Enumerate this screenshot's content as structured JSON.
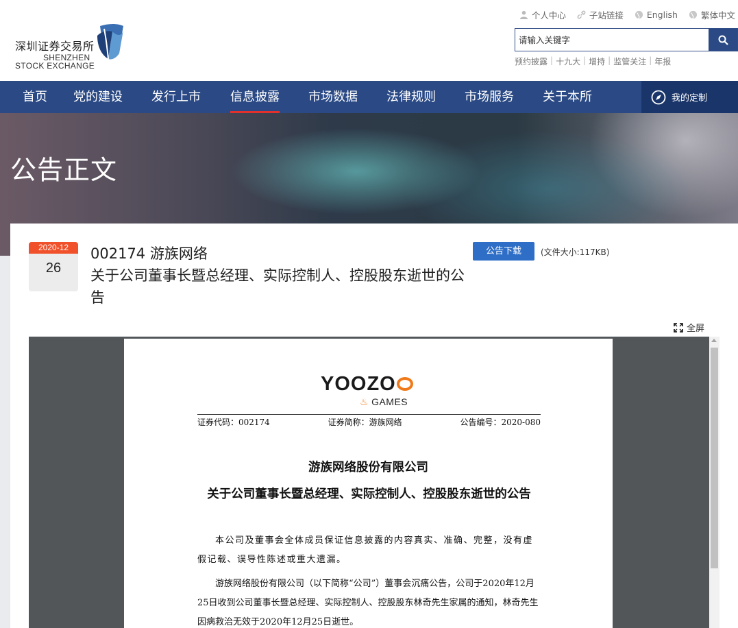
{
  "header": {
    "logo": {
      "cn": "深圳证券交易所",
      "en1": "SHENZHEN",
      "en2": "STOCK EXCHANGE"
    },
    "toplinks": [
      {
        "label": "个人中心",
        "icon": "user-icon"
      },
      {
        "label": "子站链接",
        "icon": "link-icon"
      },
      {
        "label": "English",
        "icon": "globe-icon"
      },
      {
        "label": "繁体中文",
        "icon": "globe-icon"
      }
    ],
    "search": {
      "placeholder": "请输入关键字"
    },
    "hotwords": [
      "预约披露",
      "十九大",
      "增持",
      "监管关注",
      "年报"
    ]
  },
  "nav": {
    "items": [
      "首页",
      "党的建设",
      "发行上市",
      "信息披露",
      "市场数据",
      "法律规则",
      "市场服务",
      "关于本所"
    ],
    "active": "信息披露",
    "custom": "我的定制"
  },
  "banner": {
    "title": "公告正文"
  },
  "announcement": {
    "month": "2020-12",
    "day": "26",
    "code_name": "002174 游族网络",
    "title": "关于公司董事长暨总经理、实际控制人、控股股东逝世的公告",
    "download_label": "公告下载",
    "file_size": "(文件大小:117KB)",
    "fullscreen_label": "全屏"
  },
  "document": {
    "logo_text": "YOOZO",
    "logo_sub": "GAMES",
    "security_code": "证券代码：002174",
    "security_abbr": "证券简称：游族网络",
    "notice_no": "公告编号：2020-080",
    "company": "游族网络股份有限公司",
    "heading": "关于公司董事长暨总经理、实际控制人、控股股东逝世的公告",
    "para1": "本公司及董事会全体成员保证信息披露的内容真实、准确、完整，没有虚假记载、误导性陈述或重大遗漏。",
    "para2": "游族网络股份有限公司（以下简称“公司”）董事会沉痛公告，公司于2020年12月25日收到公司董事长暨总经理、实际控制人、控股股东林奇先生家属的通知，林奇先生因病救治无效于2020年12月25日逝世。"
  },
  "colors": {
    "nav": "#2b4a85",
    "nav_active": "#e2312d",
    "download": "#2e6ec6",
    "date_month": "#f0502a",
    "yoozoo_orange": "#f07a1a"
  }
}
